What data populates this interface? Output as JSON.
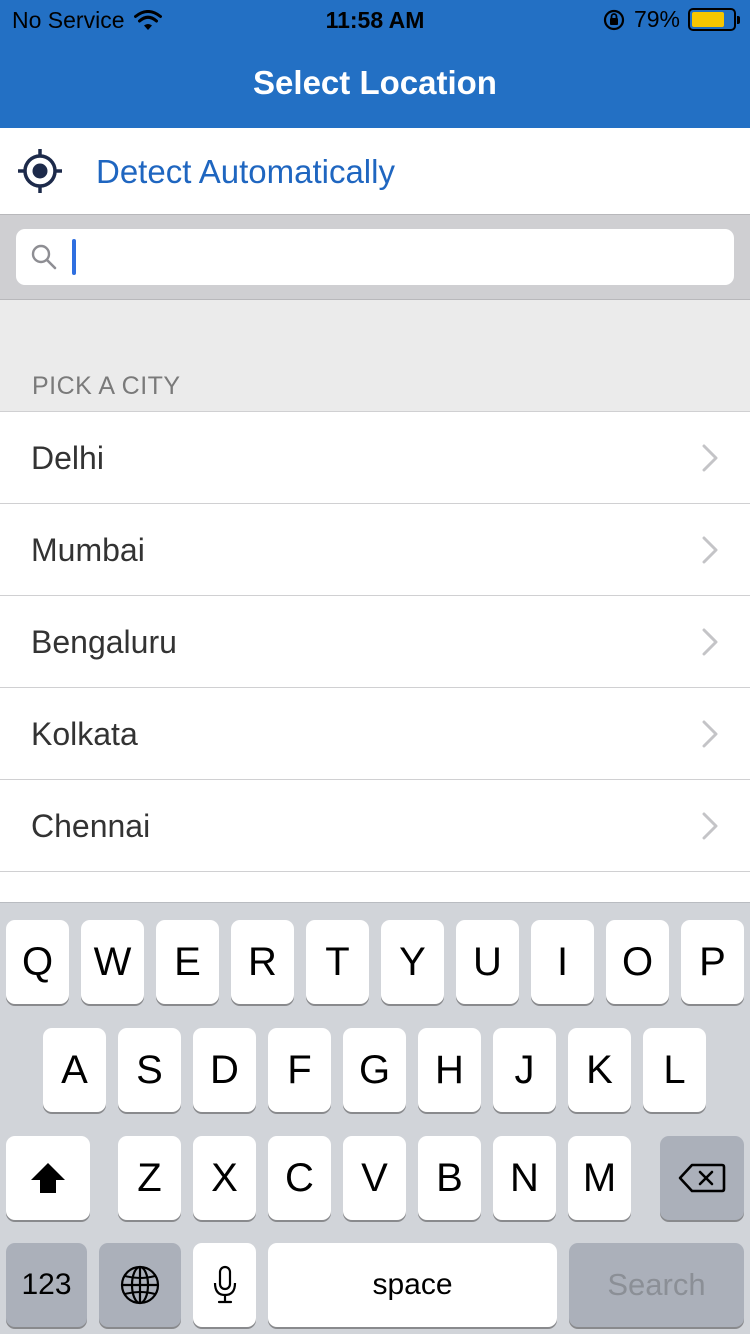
{
  "status_bar": {
    "carrier": "No Service",
    "time": "11:58 AM",
    "battery_percent": "79%",
    "battery_level": 0.79,
    "battery_color": "#f7c600"
  },
  "nav": {
    "title": "Select Location",
    "bar_color": "#2370c4"
  },
  "detect": {
    "label": "Detect Automatically",
    "icon": "location-target-icon"
  },
  "search": {
    "value": "",
    "placeholder": ""
  },
  "section": {
    "header": "PICK A CITY"
  },
  "cities": [
    {
      "name": "Delhi"
    },
    {
      "name": "Mumbai"
    },
    {
      "name": "Bengaluru"
    },
    {
      "name": "Kolkata"
    },
    {
      "name": "Chennai"
    }
  ],
  "keyboard": {
    "row1": [
      "Q",
      "W",
      "E",
      "R",
      "T",
      "Y",
      "U",
      "I",
      "O",
      "P"
    ],
    "row2": [
      "A",
      "S",
      "D",
      "F",
      "G",
      "H",
      "J",
      "K",
      "L"
    ],
    "row3": [
      "Z",
      "X",
      "C",
      "V",
      "B",
      "N",
      "M"
    ],
    "numbers_key": "123",
    "space_key": "space",
    "return_key": "Search"
  }
}
